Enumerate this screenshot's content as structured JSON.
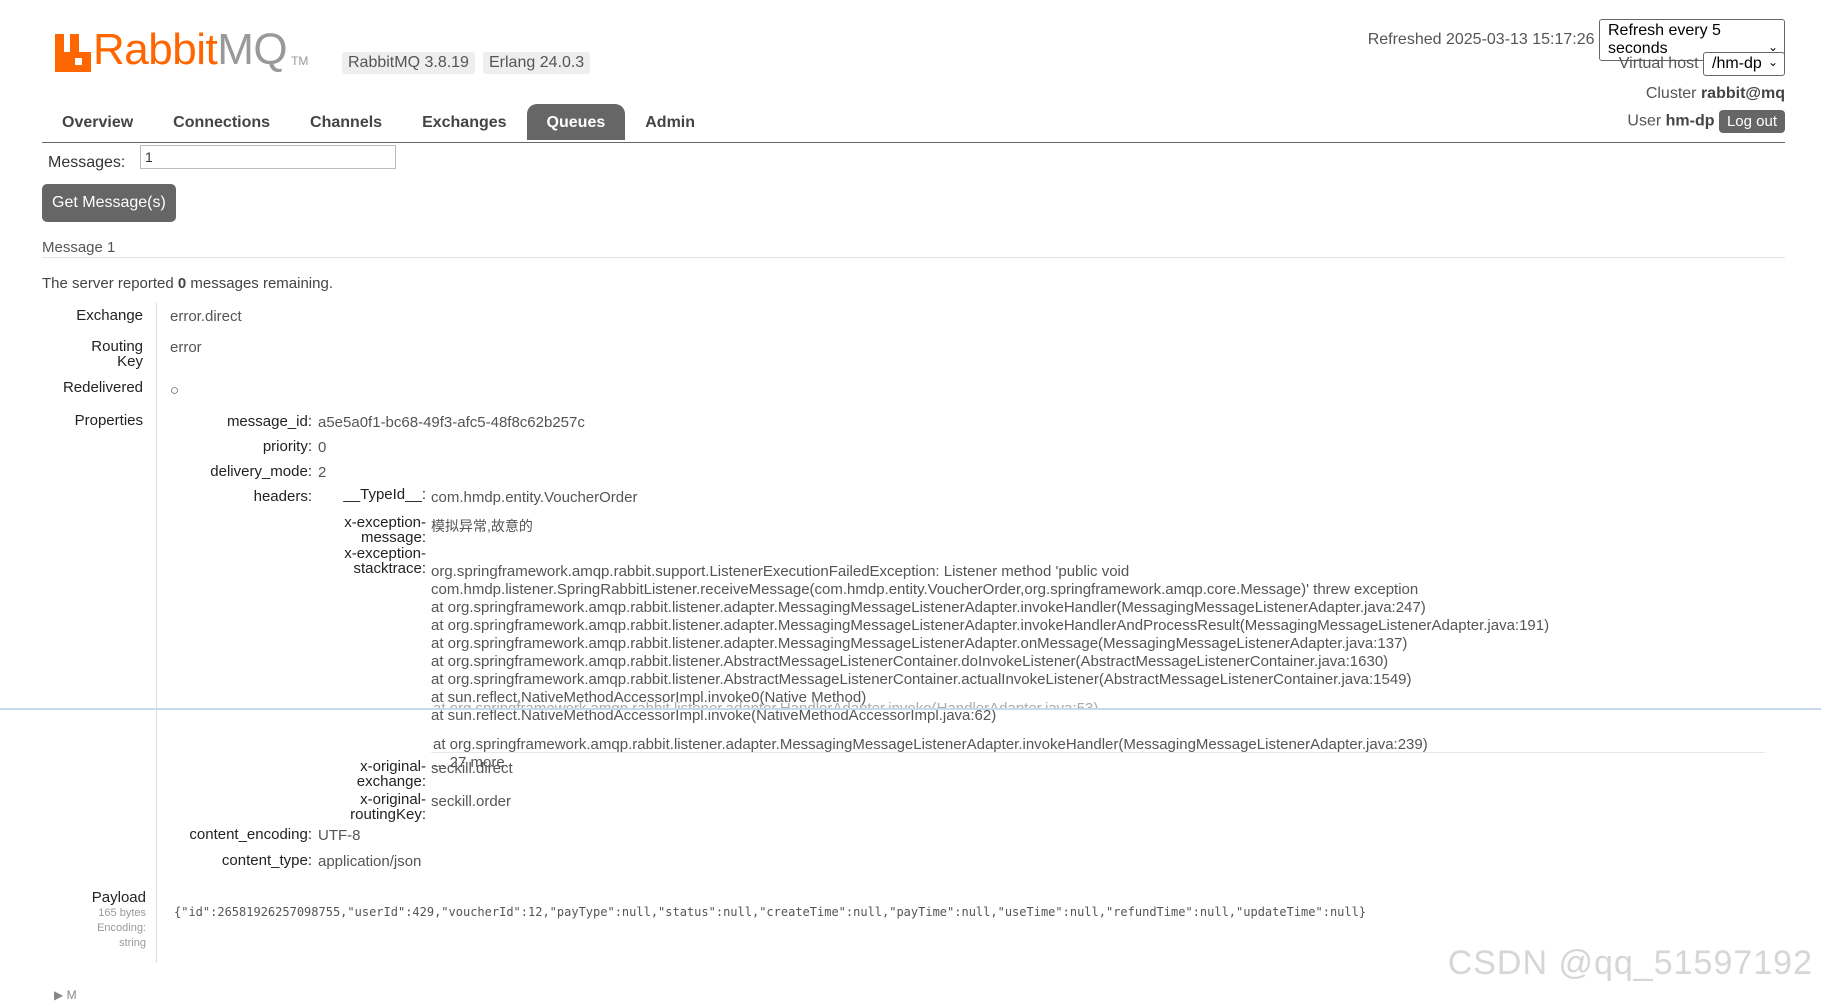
{
  "brand": {
    "name_a": "Rabbit",
    "name_b": "MQ",
    "tm": "TM",
    "version": "RabbitMQ 3.8.19",
    "erlang": "Erlang 24.0.3"
  },
  "header": {
    "refreshed_label": "Refreshed 2025-03-13 15:17:26",
    "refresh_select": "Refresh every 5 seconds",
    "vhost_label": "Virtual host",
    "vhost_select": "/hm-dp",
    "cluster_label": "Cluster",
    "cluster_value": "rabbit@mq",
    "user_label": "User",
    "user_value": "hm-dp",
    "logout": "Log out"
  },
  "nav": {
    "tabs": [
      "Overview",
      "Connections",
      "Channels",
      "Exchanges",
      "Queues",
      "Admin"
    ],
    "active": "Queues"
  },
  "get": {
    "messages_label": "Messages:",
    "messages_value": "1",
    "button": "Get Message(s)"
  },
  "message": {
    "section_title": "Message 1",
    "server_pre": "The server reported ",
    "server_count": "0",
    "server_post": " messages remaining.",
    "labels": {
      "exchange": "Exchange",
      "routing_a": "Routing",
      "routing_b": "Key",
      "redelivered": "Redelivered",
      "properties": "Properties"
    },
    "exchange": "error.direct",
    "routing_key": "error",
    "redelivered": "○",
    "properties": {
      "message_id_k": "message_id:",
      "message_id": "a5e5a0f1-bc68-49f3-afc5-48f8c62b257c",
      "priority_k": "priority:",
      "priority": "0",
      "delivery_mode_k": "delivery_mode:",
      "delivery_mode": "2",
      "headers_k": "headers:",
      "content_encoding_k": "content_encoding:",
      "content_encoding": "UTF-8",
      "content_type_k": "content_type:",
      "content_type": "application/json"
    },
    "headers": {
      "typeid_k": "__TypeId__:",
      "typeid": "com.hmdp.entity.VoucherOrder",
      "exmsg_k1": "x-exception-",
      "exmsg_k2": "message:",
      "exmsg": "模拟异常,故意的",
      "exst_k1": "x-exception-",
      "exst_k2": "stacktrace:",
      "stacktrace_top": [
        "org.springframework.amqp.rabbit.support.ListenerExecutionFailedException: Listener method 'public void",
        "com.hmdp.listener.SpringRabbitListener.receiveMessage(com.hmdp.entity.VoucherOrder,org.springframework.amqp.core.Message)' threw exception",
        "at org.springframework.amqp.rabbit.listener.adapter.MessagingMessageListenerAdapter.invokeHandler(MessagingMessageListenerAdapter.java:247)",
        "at org.springframework.amqp.rabbit.listener.adapter.MessagingMessageListenerAdapter.invokeHandlerAndProcessResult(MessagingMessageListenerAdapter.java:191)",
        "at org.springframework.amqp.rabbit.listener.adapter.MessagingMessageListenerAdapter.onMessage(MessagingMessageListenerAdapter.java:137)",
        "at org.springframework.amqp.rabbit.listener.AbstractMessageListenerContainer.doInvokeListener(AbstractMessageListenerContainer.java:1630)",
        "at org.springframework.amqp.rabbit.listener.AbstractMessageListenerContainer.actualInvokeListener(AbstractMessageListenerContainer.java:1549)",
        "at sun.reflect.NativeMethodAccessorImpl.invoke0(Native Method)",
        "at sun.reflect.NativeMethodAccessorImpl.invoke(NativeMethodAccessorImpl.java:62)"
      ],
      "stacktrace_bottom": [
        "at org.springframework.amqp.rabbit.listener.adapter.MessagingMessageListenerAdapter.invokeHandler(MessagingMessageListenerAdapter.java:239)",
        "... 27 more"
      ],
      "ghost_line": "at org.springframework.amqp.rabbit.listener.adapter.HandlerAdapter.invoke(HandlerAdapter.java:53)",
      "oex_k1": "x-original-",
      "oex_k2": "exchange:",
      "oex": "seckill.direct",
      "ork_k1": "x-original-",
      "ork_k2": "routingKey:",
      "ork": "seckill.order"
    },
    "payload": {
      "label": "Payload",
      "bytes": "165 bytes",
      "encoding_label": "Encoding:",
      "encoding": "string",
      "value": "{\"id\":26581926257098755,\"userId\":429,\"voucherId\":12,\"payType\":null,\"status\":null,\"createTime\":null,\"payTime\":null,\"useTime\":null,\"refundTime\":null,\"updateTime\":null}"
    }
  },
  "watermark": "CSDN @qq_51597192",
  "footer_arrow": "▶ M"
}
